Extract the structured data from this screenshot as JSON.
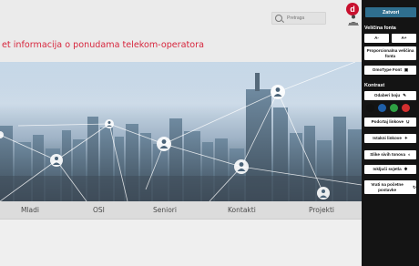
{
  "header": {
    "search_placeholder": "Pretraga",
    "a11y_icon_letter": "d"
  },
  "page": {
    "heading": "et informacija o ponudama telekom-operatora"
  },
  "nav": {
    "items": [
      "Mladi",
      "OSI",
      "Seniori",
      "Kontakti",
      "Projekti"
    ]
  },
  "panel": {
    "close_label": "Zatvori",
    "font_size_label": "Veličina fonta",
    "font_decrease": "A-",
    "font_increase": "A+",
    "proportional_font": "Proporcionalna veličina fonta",
    "omnitype_font": "OmoType Font",
    "contrast_label": "Kontrast",
    "choose_color": "Odaberi boju",
    "underline_links": "Podcrtaj linkove",
    "highlight_links": "Istakni linkove",
    "grayscale_images": "Slike sivih tonova",
    "turn_off_lights": "Isključi svjetla",
    "reset_settings": "Vrati na početne postavke",
    "swatch_colors": [
      "#111111",
      "#1f5fa8",
      "#2ea043",
      "#d32f2f"
    ]
  }
}
